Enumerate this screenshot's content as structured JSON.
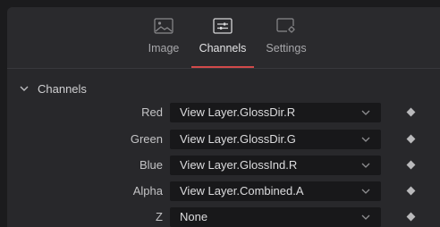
{
  "tabs": [
    {
      "label": "Image",
      "icon": "image-icon",
      "active": false
    },
    {
      "label": "Channels",
      "icon": "sliders-icon",
      "active": true
    },
    {
      "label": "Settings",
      "icon": "gear-icon",
      "active": false
    }
  ],
  "section": {
    "title": "Channels",
    "expanded": true
  },
  "channels": [
    {
      "name": "Red",
      "value": "View Layer.GlossDir.R"
    },
    {
      "name": "Green",
      "value": "View Layer.GlossDir.G"
    },
    {
      "name": "Blue",
      "value": "View Layer.GlossInd.R"
    },
    {
      "name": "Alpha",
      "value": "View Layer.Combined.A"
    },
    {
      "name": "Z",
      "value": "None"
    }
  ],
  "colors": {
    "accent": "#d24a4a",
    "panel": "#28282b",
    "field": "#18181a"
  }
}
